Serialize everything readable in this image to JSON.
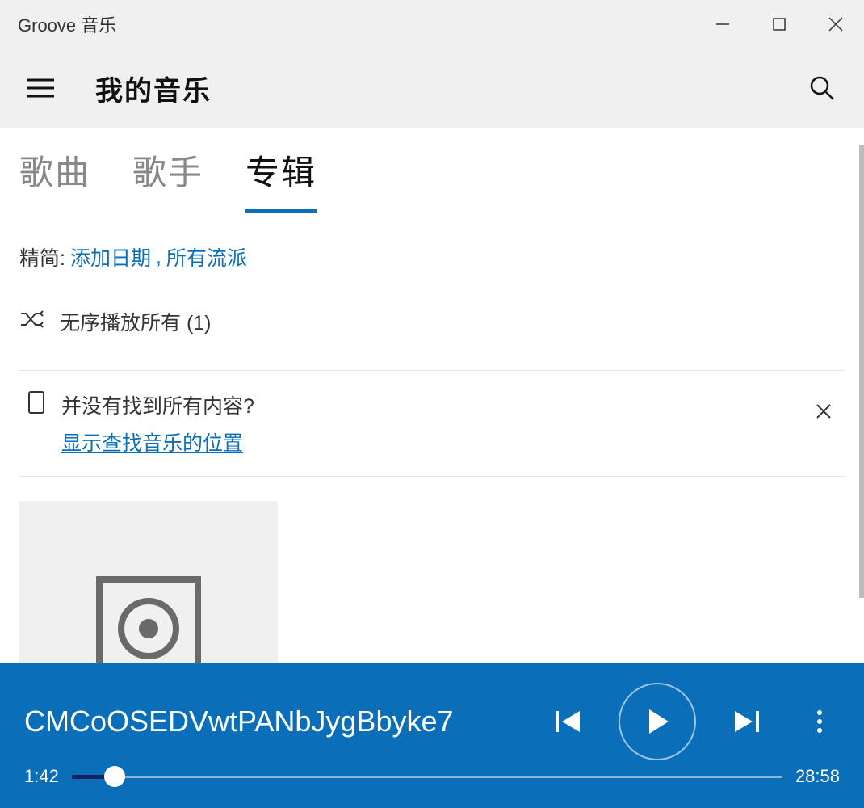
{
  "window": {
    "title": "Groove 音乐"
  },
  "header": {
    "page_title": "我的音乐"
  },
  "tabs": {
    "songs": "歌曲",
    "artists": "歌手",
    "albums": "专辑"
  },
  "filter": {
    "label": "精简:",
    "sort": "添加日期",
    "sep": ", ",
    "genre": "所有流派"
  },
  "shuffle": {
    "label": "无序播放所有 (1)"
  },
  "notice": {
    "question": "并没有找到所有内容?",
    "link": "显示查找音乐的位置"
  },
  "player": {
    "track_title": "CMCoOSEDVwtPANbJygBbyke7",
    "elapsed": "1:42",
    "remaining": "28:58"
  }
}
